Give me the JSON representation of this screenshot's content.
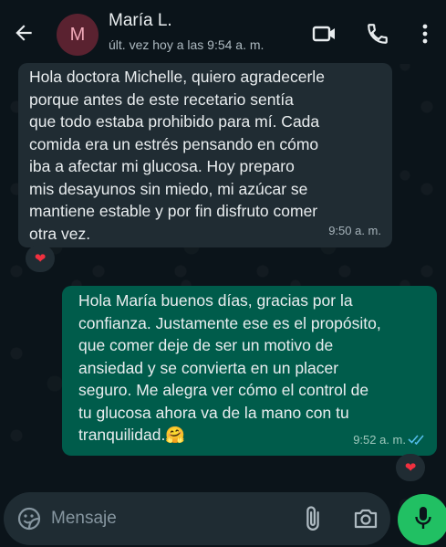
{
  "colors": {
    "background": "#0b141a",
    "incoming_bubble": "#202c33",
    "outgoing_bubble": "#005c4b",
    "accent_green": "#21c063",
    "read_ticks": "#53bdeb",
    "reaction_heart": "#f1303f"
  },
  "header": {
    "avatar_initial": "M",
    "contact_name": "María L.",
    "status": "últ. vez hoy a las 9:54 a. m.",
    "icons": [
      "back-arrow-icon",
      "video-call-icon",
      "phone-call-icon",
      "more-options-icon"
    ]
  },
  "messages": [
    {
      "direction": "incoming",
      "text": "Hola doctora Michelle, quiero agradecerle\nporque antes de este recetario sentía\nque todo estaba prohibido para mí. Cada\ncomida era un estrés pensando en cómo\niba a afectar mi glucosa. Hoy preparo\nmis desayunos sin miedo, mi azúcar se\nmantiene estable y por fin disfruto comer\notra vez.",
      "time": "9:50 a. m.",
      "reaction": "❤"
    },
    {
      "direction": "outgoing",
      "text": "Hola María buenos días, gracias por la\nconfianza. Justamente ese es el propósito,\nque comer deje de ser un motivo de\nansiedad y se convierta en un placer\nseguro. Me alegra ver cómo el control de\ntu glucosa ahora va de la mano con tu\ntranquilidad.🤗",
      "time": "9:52 a. m.",
      "status": "read",
      "reaction": "❤"
    }
  ],
  "composer": {
    "placeholder": "Mensaje",
    "value": "",
    "icons": [
      "sticker-icon",
      "attach-clip-icon",
      "camera-icon",
      "mic-icon"
    ]
  }
}
